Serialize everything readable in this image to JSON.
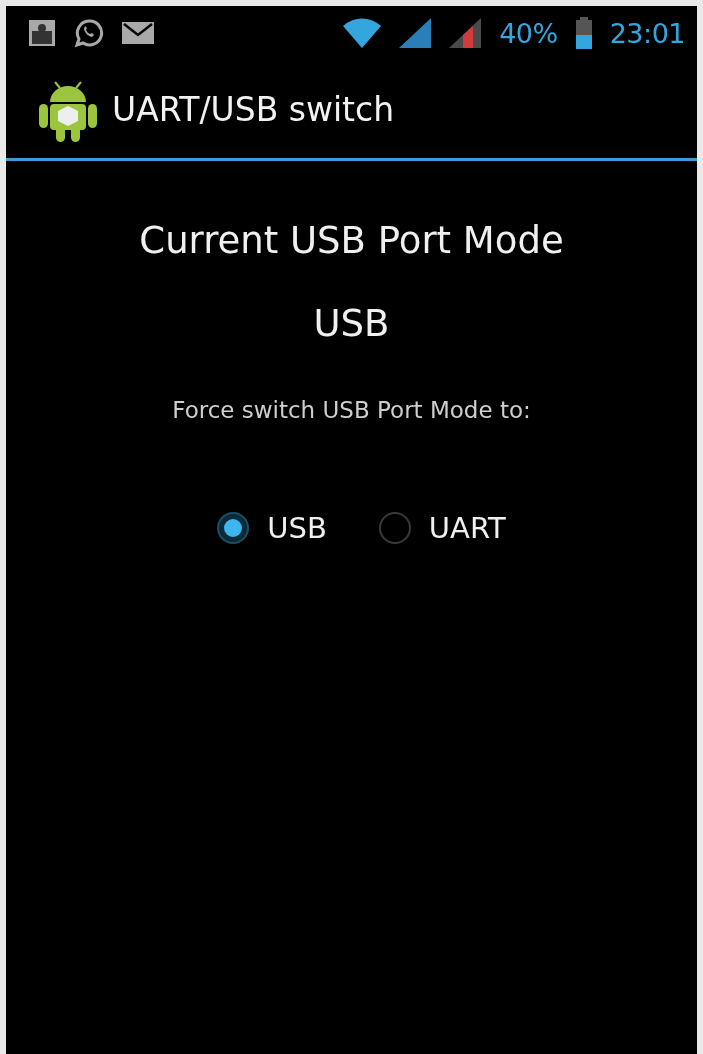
{
  "status_bar": {
    "battery_percent": "40%",
    "time": "23:01"
  },
  "app_bar": {
    "title": "UART/USB switch"
  },
  "heading": "Current USB Port Mode",
  "current_mode": "USB",
  "prompt": "Force switch USB Port Mode to:",
  "options": [
    {
      "label": "USB",
      "selected": true
    },
    {
      "label": "UART",
      "selected": false
    }
  ]
}
